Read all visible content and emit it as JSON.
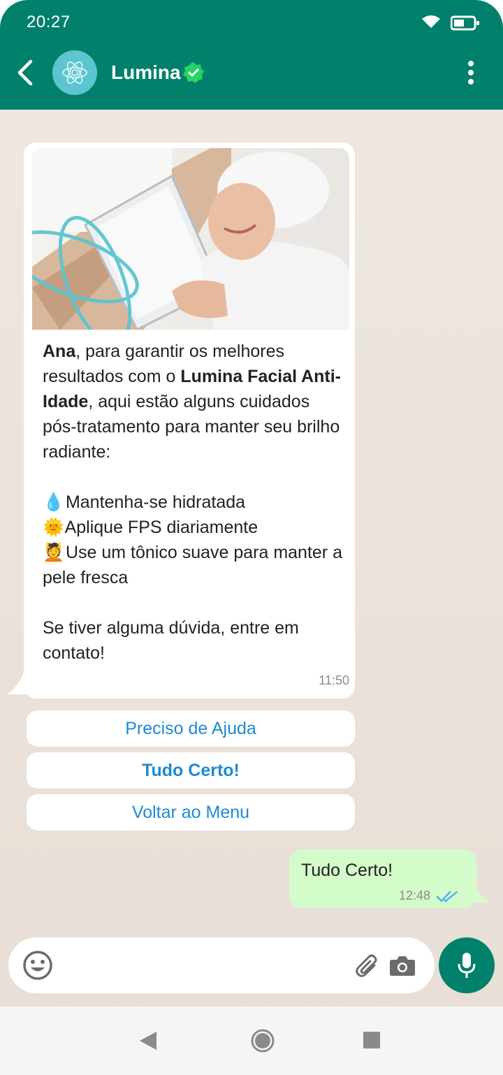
{
  "status_bar": {
    "time": "20:27"
  },
  "header": {
    "title": "Lumina"
  },
  "message_in": {
    "name": "Ana",
    "intro_1": ", para garantir os melhores resultados com o ",
    "product": "Lumina Facial Anti-Idade",
    "intro_2": ", aqui estão alguns cuidados pós-tratamento para manter seu brilho radiante:",
    "tips": [
      {
        "emoji": "💧",
        "text": "Mantenha-se hidratada"
      },
      {
        "emoji": "🌞",
        "text": "Aplique FPS diariamente"
      },
      {
        "emoji": "💆",
        "text": "Use um tônico suave para manter a pele fresca"
      }
    ],
    "closing": "Se tiver alguma dúvida, entre em contato!",
    "time": "11:50"
  },
  "quick_replies": [
    "Preciso de Ajuda",
    "Tudo Certo!",
    "Voltar ao Menu"
  ],
  "message_out": {
    "text": "Tudo Certo!",
    "time": "12:48"
  },
  "input": {
    "placeholder": ""
  },
  "colors": {
    "primary": "#01806b",
    "link": "#1f8ad1",
    "outgoing_bubble": "#d4fccb"
  }
}
